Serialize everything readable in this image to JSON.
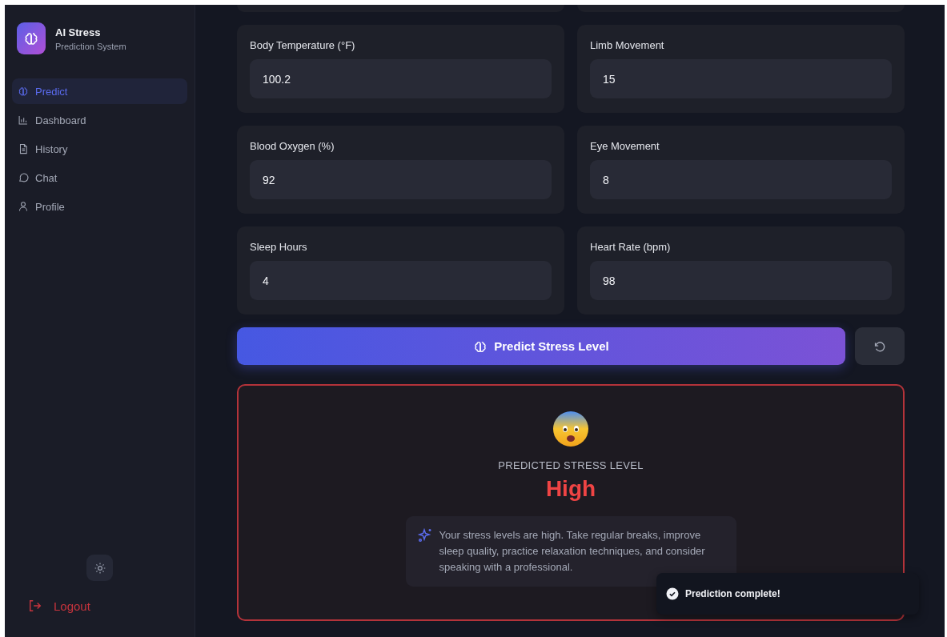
{
  "brand": {
    "title": "AI Stress",
    "subtitle": "Prediction System"
  },
  "nav": [
    {
      "label": "Predict",
      "kind": "brain",
      "selected": true
    },
    {
      "label": "Dashboard",
      "kind": "chart",
      "selected": false
    },
    {
      "label": "History",
      "kind": "file",
      "selected": false
    },
    {
      "label": "Chat",
      "kind": "chat",
      "selected": false
    },
    {
      "label": "Profile",
      "kind": "user",
      "selected": false
    }
  ],
  "logout": "Logout",
  "fields": [
    {
      "label": "Body Temperature (°F)",
      "value": "100.2"
    },
    {
      "label": "Limb Movement",
      "value": "15"
    },
    {
      "label": "Blood Oxygen (%)",
      "value": "92"
    },
    {
      "label": "Eye Movement",
      "value": "8"
    },
    {
      "label": "Sleep Hours",
      "value": "4"
    },
    {
      "label": "Heart Rate (bpm)",
      "value": "98"
    }
  ],
  "predict_button": "Predict Stress Level",
  "result": {
    "kind": "high",
    "caption": "PREDICTED STRESS LEVEL",
    "level": "High",
    "advice": "Your stress levels are high. Take regular breaks, improve sleep quality, practice relaxation techniques, and consider speaking with a professional."
  },
  "toast": "Prediction complete!"
}
